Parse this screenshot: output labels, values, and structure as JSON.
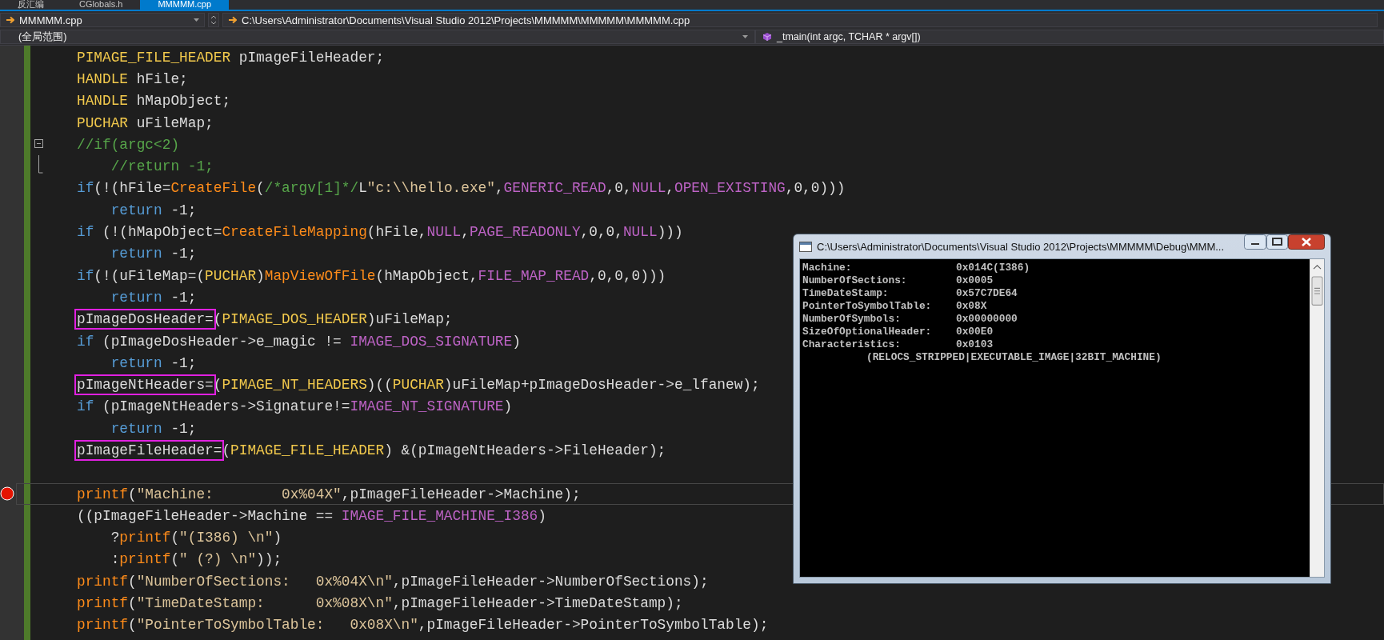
{
  "tabs": [
    {
      "label": "反汇编",
      "selected": false
    },
    {
      "label": "CGlobals.h",
      "selected": false
    },
    {
      "label": "MMMMM.cpp",
      "selected": true
    }
  ],
  "navigation_bar": {
    "file": "MMMMM.cpp",
    "path": "C:\\Users\\Administrator\\Documents\\Visual Studio 2012\\Projects\\MMMMM\\MMMMM\\MMMMM.cpp"
  },
  "scope_bar": {
    "scope": "(全局范围)",
    "member": "_tmain(int argc, TCHAR * argv[])"
  },
  "editor": {
    "lines": [
      {
        "kind": "code",
        "segments": [
          {
            "kind": "type",
            "text": "PIMAGE_FILE_HEADER"
          },
          {
            "kind": "plain",
            "text": " pImageFileHeader;"
          }
        ]
      },
      {
        "kind": "code",
        "segments": [
          {
            "kind": "type",
            "text": "HANDLE"
          },
          {
            "kind": "plain",
            "text": " hFile;"
          }
        ]
      },
      {
        "kind": "code",
        "segments": [
          {
            "kind": "type",
            "text": "HANDLE"
          },
          {
            "kind": "plain",
            "text": " hMapObject;"
          }
        ]
      },
      {
        "kind": "code",
        "segments": [
          {
            "kind": "type",
            "text": "PUCHAR"
          },
          {
            "kind": "plain",
            "text": " uFileMap;"
          }
        ]
      },
      {
        "kind": "fold",
        "segments": [
          {
            "kind": "comment",
            "text": "//if(argc<2)"
          }
        ]
      },
      {
        "kind": "fold-end",
        "segments": [
          {
            "kind": "comment",
            "text": "    //return -1;"
          }
        ]
      },
      {
        "kind": "code",
        "segments": [
          {
            "kind": "keyword",
            "text": "if"
          },
          {
            "kind": "plain",
            "text": "(!(hFile="
          },
          {
            "kind": "func",
            "text": "CreateFile"
          },
          {
            "kind": "plain",
            "text": "("
          },
          {
            "kind": "comment",
            "text": "/*argv[1]*/"
          },
          {
            "kind": "plain",
            "text": "L"
          },
          {
            "kind": "string",
            "text": "\"c:\\\\hello.exe\""
          },
          {
            "kind": "plain",
            "text": ","
          },
          {
            "kind": "macro",
            "text": "GENERIC_READ"
          },
          {
            "kind": "plain",
            "text": ",0,"
          },
          {
            "kind": "macro",
            "text": "NULL"
          },
          {
            "kind": "plain",
            "text": ","
          },
          {
            "kind": "macro",
            "text": "OPEN_EXISTING"
          },
          {
            "kind": "plain",
            "text": ",0,0)))"
          }
        ]
      },
      {
        "kind": "code",
        "segments": [
          {
            "kind": "keyword",
            "text": "    return"
          },
          {
            "kind": "plain",
            "text": " -1;"
          }
        ]
      },
      {
        "kind": "code",
        "segments": [
          {
            "kind": "keyword",
            "text": "if"
          },
          {
            "kind": "plain",
            "text": " (!(hMapObject="
          },
          {
            "kind": "func",
            "text": "CreateFileMapping"
          },
          {
            "kind": "plain",
            "text": "(hFile,"
          },
          {
            "kind": "macro",
            "text": "NULL"
          },
          {
            "kind": "plain",
            "text": ","
          },
          {
            "kind": "macro",
            "text": "PAGE_READONLY"
          },
          {
            "kind": "plain",
            "text": ",0,0,"
          },
          {
            "kind": "macro",
            "text": "NULL"
          },
          {
            "kind": "plain",
            "text": ")))"
          }
        ]
      },
      {
        "kind": "code",
        "segments": [
          {
            "kind": "keyword",
            "text": "    return"
          },
          {
            "kind": "plain",
            "text": " -1;"
          }
        ]
      },
      {
        "kind": "code",
        "segments": [
          {
            "kind": "keyword",
            "text": "if"
          },
          {
            "kind": "plain",
            "text": "(!(uFileMap=("
          },
          {
            "kind": "type",
            "text": "PUCHAR"
          },
          {
            "kind": "plain",
            "text": ")"
          },
          {
            "kind": "func",
            "text": "MapViewOfFile"
          },
          {
            "kind": "plain",
            "text": "(hMapObject,"
          },
          {
            "kind": "macro",
            "text": "FILE_MAP_READ"
          },
          {
            "kind": "plain",
            "text": ",0,0,0)))"
          }
        ]
      },
      {
        "kind": "code",
        "segments": [
          {
            "kind": "keyword",
            "text": "    return"
          },
          {
            "kind": "plain",
            "text": " -1;"
          }
        ]
      },
      {
        "kind": "code",
        "segments": [
          {
            "kind": "boxed",
            "text": "pImageDosHeader="
          },
          {
            "kind": "plain",
            "text": "("
          },
          {
            "kind": "type",
            "text": "PIMAGE_DOS_HEADER"
          },
          {
            "kind": "plain",
            "text": ")uFileMap;"
          }
        ]
      },
      {
        "kind": "code",
        "segments": [
          {
            "kind": "keyword",
            "text": "if"
          },
          {
            "kind": "plain",
            "text": " (pImageDosHeader->e_magic != "
          },
          {
            "kind": "macro",
            "text": "IMAGE_DOS_SIGNATURE"
          },
          {
            "kind": "plain",
            "text": ")"
          }
        ]
      },
      {
        "kind": "code",
        "segments": [
          {
            "kind": "keyword",
            "text": "    return"
          },
          {
            "kind": "plain",
            "text": " -1;"
          }
        ]
      },
      {
        "kind": "code",
        "segments": [
          {
            "kind": "boxed",
            "text": "pImageNtHeaders="
          },
          {
            "kind": "plain",
            "text": "("
          },
          {
            "kind": "type",
            "text": "PIMAGE_NT_HEADERS"
          },
          {
            "kind": "plain",
            "text": ")(("
          },
          {
            "kind": "type",
            "text": "PUCHAR"
          },
          {
            "kind": "plain",
            "text": ")uFileMap+pImageDosHeader->e_lfanew);"
          }
        ]
      },
      {
        "kind": "code",
        "segments": [
          {
            "kind": "keyword",
            "text": "if"
          },
          {
            "kind": "plain",
            "text": " (pImageNtHeaders->Signature!="
          },
          {
            "kind": "macro",
            "text": "IMAGE_NT_SIGNATURE"
          },
          {
            "kind": "plain",
            "text": ")"
          }
        ]
      },
      {
        "kind": "code",
        "segments": [
          {
            "kind": "keyword",
            "text": "    return"
          },
          {
            "kind": "plain",
            "text": " -1;"
          }
        ]
      },
      {
        "kind": "code",
        "segments": [
          {
            "kind": "boxed",
            "text": "pImageFileHeader="
          },
          {
            "kind": "plain",
            "text": "("
          },
          {
            "kind": "type",
            "text": "PIMAGE_FILE_HEADER"
          },
          {
            "kind": "plain",
            "text": ") &(pImageNtHeaders->FileHeader);"
          }
        ]
      },
      {
        "kind": "blank"
      },
      {
        "kind": "breakpoint",
        "segments": [
          {
            "kind": "func",
            "text": "printf"
          },
          {
            "kind": "plain",
            "text": "("
          },
          {
            "kind": "string",
            "text": "\"Machine:        0x%04X\""
          },
          {
            "kind": "plain",
            "text": ",pImageFileHeader->Machine);"
          }
        ]
      },
      {
        "kind": "code",
        "segments": [
          {
            "kind": "plain",
            "text": "((pImageFileHeader->Machine == "
          },
          {
            "kind": "macro",
            "text": "IMAGE_FILE_MACHINE_I386"
          },
          {
            "kind": "plain",
            "text": ")"
          }
        ]
      },
      {
        "kind": "code",
        "segments": [
          {
            "kind": "plain",
            "text": "    ?"
          },
          {
            "kind": "func",
            "text": "printf"
          },
          {
            "kind": "plain",
            "text": "("
          },
          {
            "kind": "string",
            "text": "\"(I386) \\n\""
          },
          {
            "kind": "plain",
            "text": ")"
          }
        ]
      },
      {
        "kind": "code",
        "segments": [
          {
            "kind": "plain",
            "text": "    :"
          },
          {
            "kind": "func",
            "text": "printf"
          },
          {
            "kind": "plain",
            "text": "("
          },
          {
            "kind": "string",
            "text": "\" (?) \\n\""
          },
          {
            "kind": "plain",
            "text": "));"
          }
        ]
      },
      {
        "kind": "code",
        "segments": [
          {
            "kind": "func",
            "text": "printf"
          },
          {
            "kind": "plain",
            "text": "("
          },
          {
            "kind": "string",
            "text": "\"NumberOfSections:   0x%04X\\n\""
          },
          {
            "kind": "plain",
            "text": ",pImageFileHeader->NumberOfSections);"
          }
        ]
      },
      {
        "kind": "code",
        "segments": [
          {
            "kind": "func",
            "text": "printf"
          },
          {
            "kind": "plain",
            "text": "("
          },
          {
            "kind": "string",
            "text": "\"TimeDateStamp:      0x%08X\\n\""
          },
          {
            "kind": "plain",
            "text": ",pImageFileHeader->TimeDateStamp);"
          }
        ]
      },
      {
        "kind": "code",
        "segments": [
          {
            "kind": "func",
            "text": "printf"
          },
          {
            "kind": "plain",
            "text": "("
          },
          {
            "kind": "string",
            "text": "\"PointerToSymbolTable:   0x08X\\n\""
          },
          {
            "kind": "plain",
            "text": ",pImageFileHeader->PointerToSymbolTable);"
          }
        ]
      }
    ]
  },
  "console_window": {
    "title": "C:\\Users\\Administrator\\Documents\\Visual Studio 2012\\Projects\\MMMMM\\Debug\\MMM...",
    "lines": [
      {
        "kind": "field",
        "label": "Machine:",
        "value": "0x014C(I386)"
      },
      {
        "kind": "field",
        "label": "NumberOfSections:",
        "value": "0x0005"
      },
      {
        "kind": "field",
        "label": "TimeDateStamp:",
        "value": "0x57C7DE64"
      },
      {
        "kind": "field",
        "label": "PointerToSymbolTable:",
        "value": "0x08X"
      },
      {
        "kind": "field",
        "label": "NumberOfSymbols:",
        "value": "0x00000000"
      },
      {
        "kind": "field",
        "label": "SizeOfOptionalHeader:",
        "value": "0x00E0"
      },
      {
        "kind": "field",
        "label": "Characteristics:",
        "value": "0x0103"
      },
      {
        "kind": "text",
        "text": "(RELOCS_STRIPPED|EXECUTABLE_IMAGE|32BIT_MACHINE)"
      }
    ]
  }
}
